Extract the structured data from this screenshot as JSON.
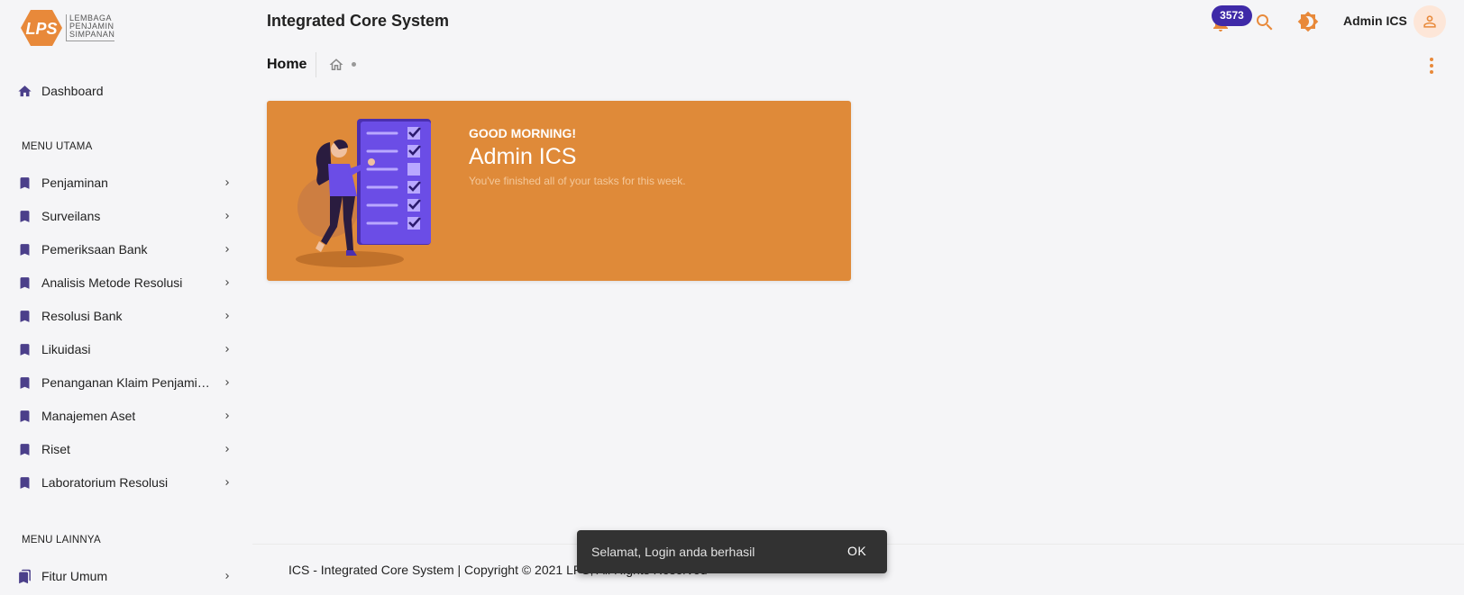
{
  "brand": {
    "logo_lines": [
      "LEMBAGA",
      "PENJAMIN",
      "SIMPANAN"
    ],
    "logo_mark": "LPS"
  },
  "header": {
    "app_title": "Integrated Core System",
    "notification_count": "3573",
    "user_name": "Admin ICS"
  },
  "sidebar": {
    "dashboard_label": "Dashboard",
    "section_main": "MENU UTAMA",
    "main_items": [
      {
        "label": "Penjaminan"
      },
      {
        "label": "Surveilans"
      },
      {
        "label": "Pemeriksaan Bank"
      },
      {
        "label": "Analisis Metode Resolusi"
      },
      {
        "label": "Resolusi Bank"
      },
      {
        "label": "Likuidasi"
      },
      {
        "label": "Penanganan Klaim Penjaminan"
      },
      {
        "label": "Manajemen Aset"
      },
      {
        "label": "Riset"
      },
      {
        "label": "Laboratorium Resolusi"
      }
    ],
    "section_other": "MENU LAINNYA",
    "other_items": [
      {
        "label": "Fitur Umum"
      }
    ]
  },
  "breadcrumb": {
    "page_title": "Home"
  },
  "welcome": {
    "greeting": "GOOD MORNING!",
    "name": "Admin ICS",
    "subtitle": "You've finished all of your tasks for this week."
  },
  "footer": {
    "text": "ICS - Integrated Core System | Copyright © 2021 LPS, All Rights Reserved"
  },
  "snackbar": {
    "message": "Selamat, Login anda berhasil",
    "action": "OK"
  },
  "colors": {
    "accent": "#df8a39",
    "nav_icon": "#4b3f8a",
    "badge": "#3f2aa8"
  }
}
